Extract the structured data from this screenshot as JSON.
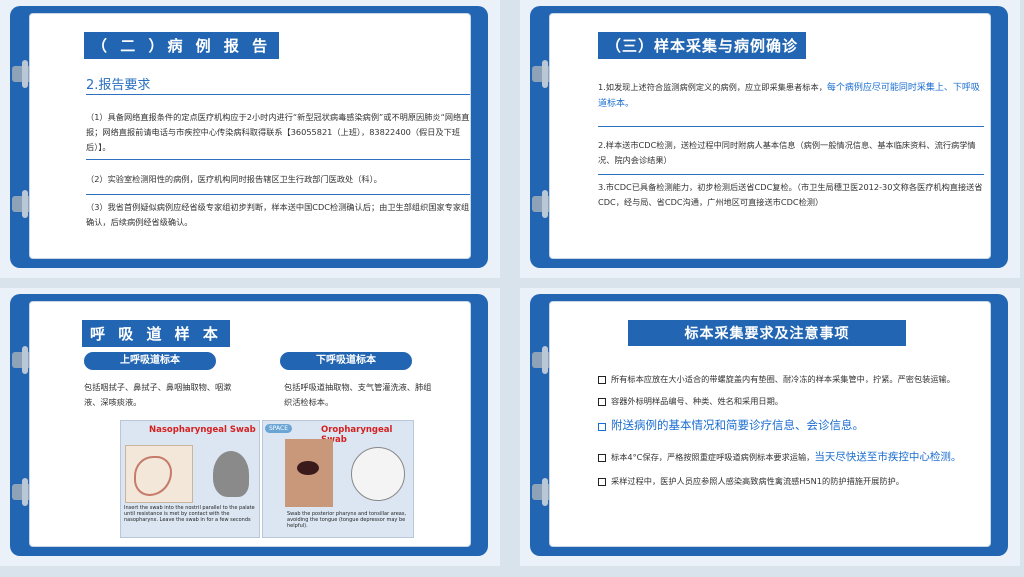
{
  "slide1": {
    "title": "（ 二 ）病 例 报 告",
    "section": "2.报告要求",
    "p1": "（1）具备网络直报条件的定点医疗机构应于2小时内进行“新型冠状病毒感染病例”或不明原因肺炎“网络直报；网络直报前请电话与市疾控中心传染病科取得联系【36055821（上班），83822400（假日及下班后）】。",
    "p2": "（2）实验室检测阳性的病例，医疗机构同时报告辖区卫生行政部门医政处（科）。",
    "p3": "（3）我省首例疑似病例应经省级专家组初步判断，样本送中国CDC检测确认后；由卫生部组织国家专家组确认，后续病例经省级确认。"
  },
  "slide2": {
    "title": "（三）样本采集与病例确诊",
    "p1_a": "1.如发现上述符合监测病例定义的病例，应立即采集患者标本，",
    "p1_b": "每个病例应尽可能同时采集上、下呼吸道标本。",
    "p2": "2.样本送市CDC检测，送检过程中同时附病人基本信息（病例一般情况信息、基本临床资料、流行病学情况、院内会诊结果）",
    "p3": "3.市CDC已具备检测能力，初步检测后送省CDC复检。（市卫生局穗卫医2012-30文称各医疗机构直接送省CDC，经与局、省CDC沟通，广州地区可直接送市CDC检测）"
  },
  "slide3": {
    "title": "呼 吸 道 样 本",
    "upper_label": "上呼吸道标本",
    "upper_text": "包括咽拭子、鼻拭子、鼻咽抽取物、咽漱液、深咳痰液。",
    "lower_label": "下呼吸道标本",
    "lower_text": "包括呼吸道抽取物、支气管灌洗液、肺组织活检标本。",
    "img1_title": "Nasopharyngeal Swab",
    "img1_caption": "Insert the swab into the nostril parallel to the palate until resistance is met by contact with the nasopharynx. Leave the swab in for a few seconds",
    "img2_title": "Oropharyngeal Swab",
    "img2_badge": "SPACE",
    "img2_caption": "Swab the posterior pharynx and tonsillar areas, avoiding the tongue (tongue depressor may be helpful)."
  },
  "slide4": {
    "title": "标本采集要求及注意事项",
    "b1": "所有标本应放在大小适合的带螺旋盖内有垫圈、耐冷冻的样本采集管中，拧紧。严密包装运输。",
    "b2": "容器外标明样品编号、种类、姓名和采用日期。",
    "b3": "附送病例的基本情况和简要诊疗信息、会诊信息。",
    "b4_a": "标本4°C保存，严格按照重症呼吸道病例标本要求运输，",
    "b4_b": "当天尽快送至市疾控中心检测。",
    "b5": "采样过程中，医护人员应参照人感染高致病性禽流感H5N1的防护措施开展防护。"
  }
}
